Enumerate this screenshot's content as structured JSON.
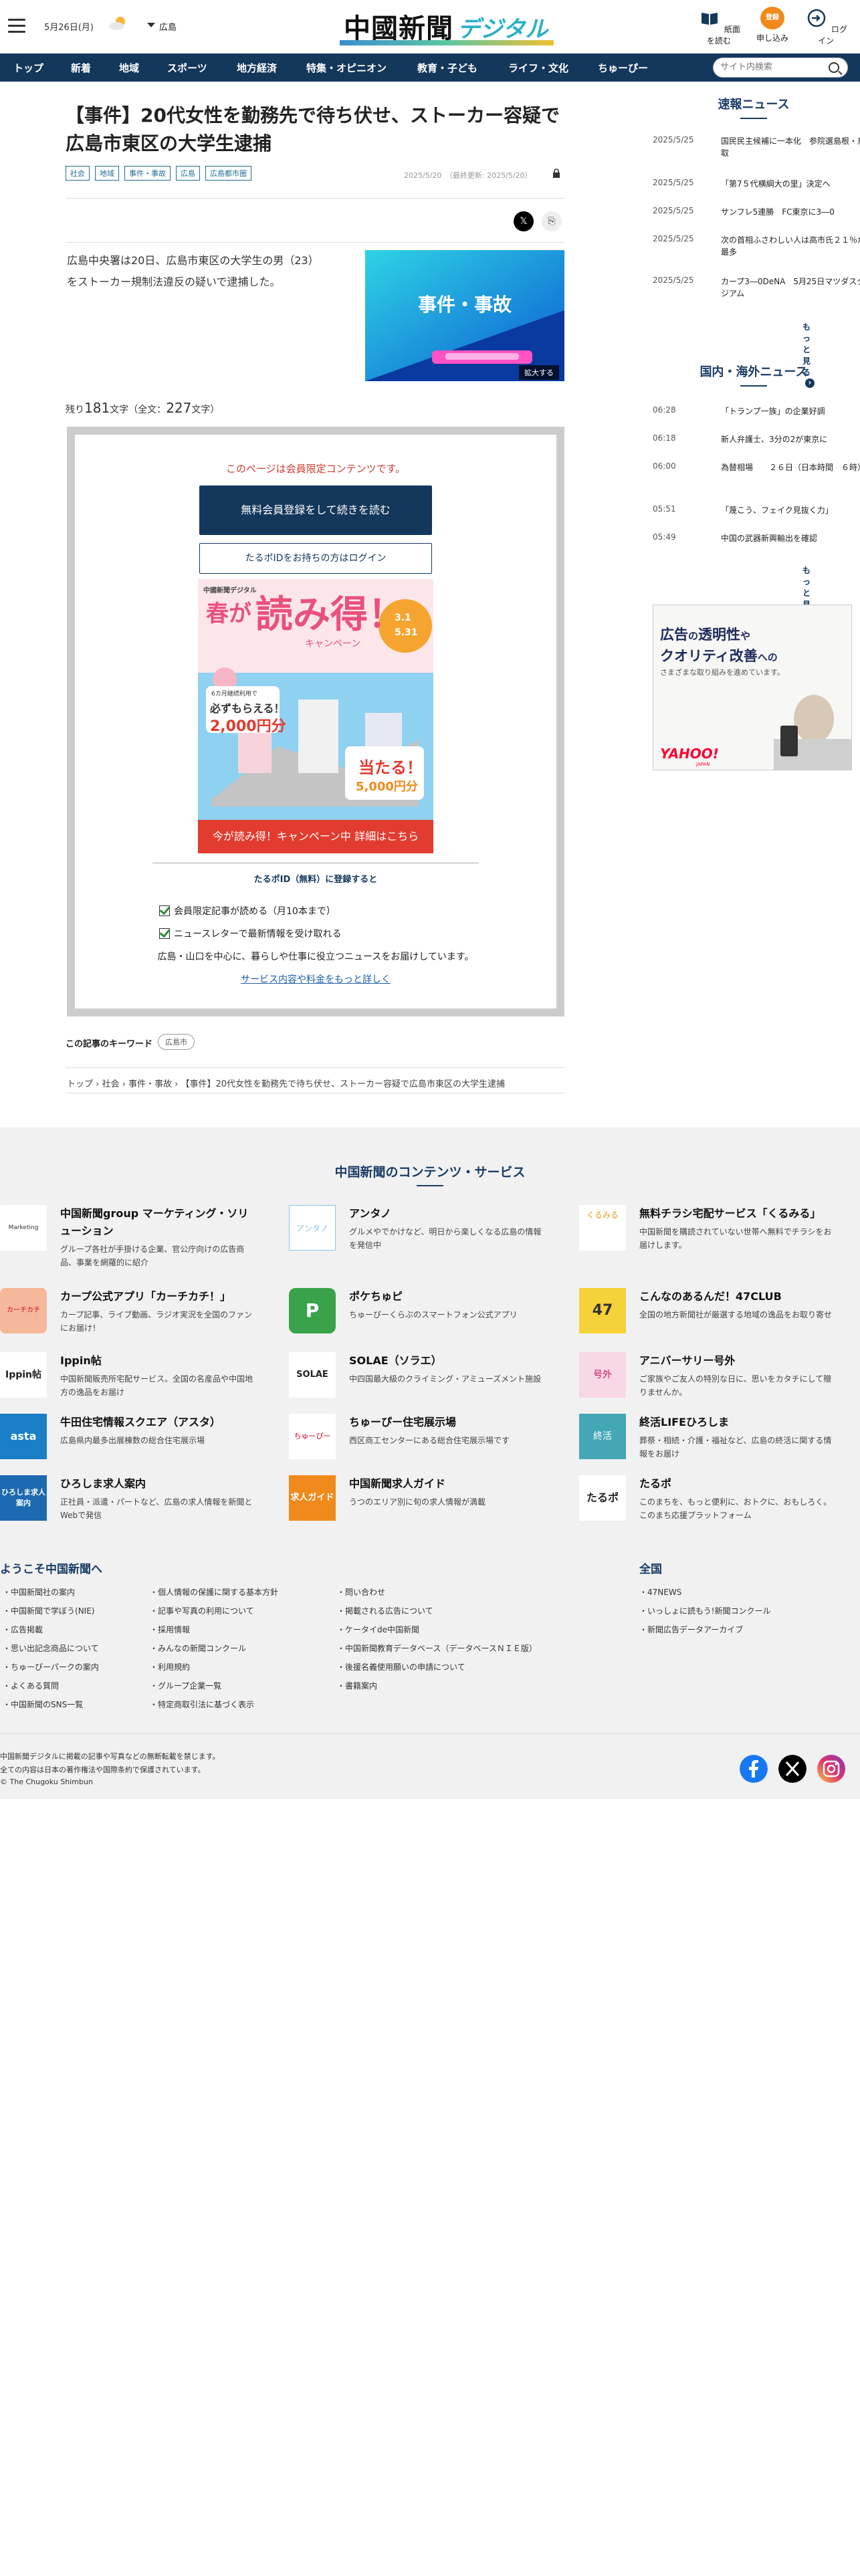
{
  "header": {
    "date": "5月26日(月)",
    "region": "広島",
    "logo_main": "中國新聞",
    "logo_sub": "デジタル",
    "icons": [
      {
        "label": "紙面を読む",
        "icon": "newspaper-icon"
      },
      {
        "label": "申し込み",
        "icon": "signup-icon"
      },
      {
        "label": "ログイン",
        "icon": "login-icon"
      }
    ],
    "signup_badge": "登録"
  },
  "nav": {
    "items": [
      "トップ",
      "新着",
      "地域",
      "スポーツ",
      "地方経済",
      "特集・オピニオン",
      "教育・子ども",
      "ライフ・文化",
      "ちゅーぴー"
    ],
    "search_placeholder": "サイト内検索"
  },
  "article": {
    "title": "【事件】20代女性を勤務先で待ち伏せ、ストーカー容疑で広島市東区の大学生逮捕",
    "tags": [
      "社会",
      "地域",
      "事件・事故",
      "広島",
      "広島都市圏"
    ],
    "date": "2025/5/20",
    "updated": "（最終更新: 2025/5/20）",
    "lead": "広島中央署は20日、広島市東区の大学生の男（23）をストーカー規制法違反の疑いで逮捕した。",
    "photo_caption": "事件・事故",
    "zoom": "拡大する",
    "remaining_prefix": "残り",
    "remaining_num": "181",
    "remaining_mid": "文字（全文：",
    "total_num": "227",
    "remaining_suffix": "文字）"
  },
  "paywall": {
    "notice": "このページは会員限定コンテンツです。",
    "register_btn": "無料会員登録をして続きを読む",
    "login_btn": "たるポIDをお持ちの方はログイン",
    "campaign_small": "中國新聞デジタル",
    "campaign_title1": "春が",
    "campaign_title2": "読み得！",
    "campaign_tag": "キャンペーン",
    "campaign_date1": "3.1",
    "campaign_date2": "5.31",
    "campaign_gift1": "必ずもらえる！",
    "campaign_gift2": "2,000円分",
    "campaign_gift_note": "6カ月継続利用で",
    "campaign_win": "当たる！",
    "campaign_win2": "5,000円分",
    "campaign_btn": "今が読み得！キャンペーン中 詳細はこちら",
    "benefit_title": "たるポID（無料）に登録すると",
    "benefits": [
      "会員限定記事が読める（月10本まで）",
      "ニュースレターで最新情報を受け取れる"
    ],
    "benefit_text": "広島・山口を中心に、暮らしや仕事に役立つニュースをお届けしています。",
    "benefit_link": "サービス内容や料金をもっと詳しく"
  },
  "keyword": {
    "label": "この記事のキーワード",
    "tag": "広島市"
  },
  "breadcrumb": [
    "トップ",
    "社会",
    "事件・事故",
    "【事件】20代女性を勤務先で待ち伏せ、ストーカー容疑で広島市東区の大学生逮捕"
  ],
  "sokuho": {
    "title": "速報ニュース",
    "items": [
      {
        "t": "2025/5/25",
        "h": "国民民主候補に一本化　参院選島根・鳥取"
      },
      {
        "t": "2025/5/25",
        "h": "「第7５代横綱大の里」決定へ"
      },
      {
        "t": "2025/5/25",
        "h": "サンフレ5連勝　FC東京に3―0"
      },
      {
        "t": "2025/5/25",
        "h": "次の首相ふさわしい人は高市氏２１％が最多"
      },
      {
        "t": "2025/5/25",
        "h": "カープ3―0DeNA　5月25日マツダスタジアム"
      }
    ],
    "more": "もっと見る"
  },
  "kokunai": {
    "title": "国内・海外ニュース",
    "items": [
      {
        "t": "06:28",
        "h": "「トランプ一族」の企業好調"
      },
      {
        "t": "06:18",
        "h": "新人弁護士、3分の2が東京に"
      },
      {
        "t": "06:00",
        "h": "為替相場　　２６日（日本時間　６時）"
      },
      {
        "t": "05:51",
        "h": "「蔑こう、フェイク見抜く力」"
      },
      {
        "t": "05:49",
        "h": "中国の武器新興輸出を確認"
      }
    ],
    "more": "もっと見る"
  },
  "ad": {
    "line1a": "広告",
    "line1b": "の",
    "line1c": "透明性",
    "line1d": "や",
    "line2a": "クオリティ改善",
    "line2b": "への",
    "line3": "さまざまな取り組みを進めています。",
    "brand": "YAHOO!",
    "brand_sub": "JAPAN"
  },
  "footer": {
    "services_title": "中国新聞のコンテンツ・サービス",
    "services": [
      {
        "name": "中国新聞group マーケティング・ソリューション",
        "desc": "グループ各社が手掛ける企業、官公庁向けの広告商品、事業を網羅的に紹介",
        "icon": "marketing-solution-icon",
        "icon_text": "Marketing Solution"
      },
      {
        "name": "アンタノ",
        "desc": "グルメやでかけなど、明日から楽しくなる広島の情報を発信中",
        "icon": "antano-icon",
        "icon_text": "アンタノ"
      },
      {
        "name": "無料チラシ宅配サービス「くるみる」",
        "desc": "中国新聞を購読されていない世帯へ無料でチラシをお届けします。",
        "icon": "kurumiru-icon",
        "icon_text": "くるみる"
      },
      {
        "name": "カープ公式アプリ「カーチカチ！」",
        "desc": "カープ記事、ライブ動画、ラジオ実況を全国のファンにお届け！",
        "icon": "carp-app-icon",
        "icon_text": "カーチカチ"
      },
      {
        "name": "ポケちゅピ",
        "desc": "ちゅーぴーくらぶのスマートフォン公式アプリ",
        "icon": "poke-chupi-icon",
        "icon_text": "P"
      },
      {
        "name": "こんなのあるんだ！47CLUB",
        "desc": "全国の地方新聞社が厳選する地域の逸品をお取り寄せ",
        "icon": "47club-icon",
        "icon_text": "47"
      },
      {
        "name": "Ippin帖",
        "desc": "中国新聞販売所宅配サービス。全国の名産品や中国地方の逸品をお届け",
        "icon": "ippin-icon",
        "icon_text": "Ippin帖"
      },
      {
        "name": "SOLAE（ソラエ）",
        "desc": "中四国最大級のクライミング・アミューズメント施設",
        "icon": "solae-icon",
        "icon_text": "SOLAE"
      },
      {
        "name": "アニバーサリー号外",
        "desc": "ご家族やご友人の特別な日に、思いをカタチにして贈りませんか。",
        "icon": "anniversary-icon",
        "icon_text": "号外"
      },
      {
        "name": "牛田住宅情報スクエア（アスタ）",
        "desc": "広島県内最多出展棟数の総合住宅展示場",
        "icon": "asta-icon",
        "icon_text": "asta"
      },
      {
        "name": "ちゅーぴー住宅展示場",
        "desc": "西区商工センターにある総合住宅展示場です",
        "icon": "chupi-house-icon",
        "icon_text": "ちゅーぴー"
      },
      {
        "name": "終活LIFEひろしま",
        "desc": "葬祭・相続・介護・福祉など、広島の終活に関する情報をお届け",
        "icon": "shukatsu-icon",
        "icon_text": "終活"
      },
      {
        "name": "ひろしま求人案内",
        "desc": "正社員・派遣・パートなど、広島の求人情報を新聞とWebで発信",
        "icon": "kyujin-icon",
        "icon_text": "ひろしま求人案内"
      },
      {
        "name": "中国新聞求人ガイド",
        "desc": "うつのエリア別に旬の求人情報が満載",
        "icon": "kyujin-guide-icon",
        "icon_text": "求人ガイド"
      },
      {
        "name": "たるポ",
        "desc": "このまちを、もっと便利に、おトクに、おもしろく。このまち応援プラットフォーム",
        "icon": "taruport-icon",
        "icon_text": "たるポ"
      }
    ],
    "welcome": "ようこそ中国新聞へ",
    "col1": [
      "中国新聞社の案内",
      "中国新聞で学ぼう(NIE)",
      "広告掲載",
      "思い出記念商品について",
      "ちゅーぴーパークの案内",
      "よくある質問",
      "中国新聞のSNS一覧"
    ],
    "col2": [
      "個人情報の保護に関する基本方針",
      "記事や写真の利用について",
      "採用情報",
      "みんなの新聞コンクール",
      "利用規約",
      "グループ企業一覧",
      "特定商取引法に基づく表示"
    ],
    "col3": [
      "問い合わせ",
      "掲載される広告について",
      "ケータイde中国新聞",
      "中国新聞教育データベース（データベースＮＩＥ版）",
      "後援名義使用願いの申請について",
      "書籍案内"
    ],
    "zenkoku": "全国",
    "col4": [
      "47NEWS",
      "いっしょに読もう!新聞コンクール",
      "新聞広告データアーカイブ"
    ],
    "copy1": "中国新聞デジタルに掲載の記事や写真などの無断転載を禁じます。",
    "copy2": "全ての内容は日本の著作権法や国際条約で保護されています。",
    "copy3": "© The Chugoku Shimbun"
  },
  "colors": {
    "navy": "#14375c",
    "red": "#e23b2f",
    "teal": "#2ab0c6"
  }
}
